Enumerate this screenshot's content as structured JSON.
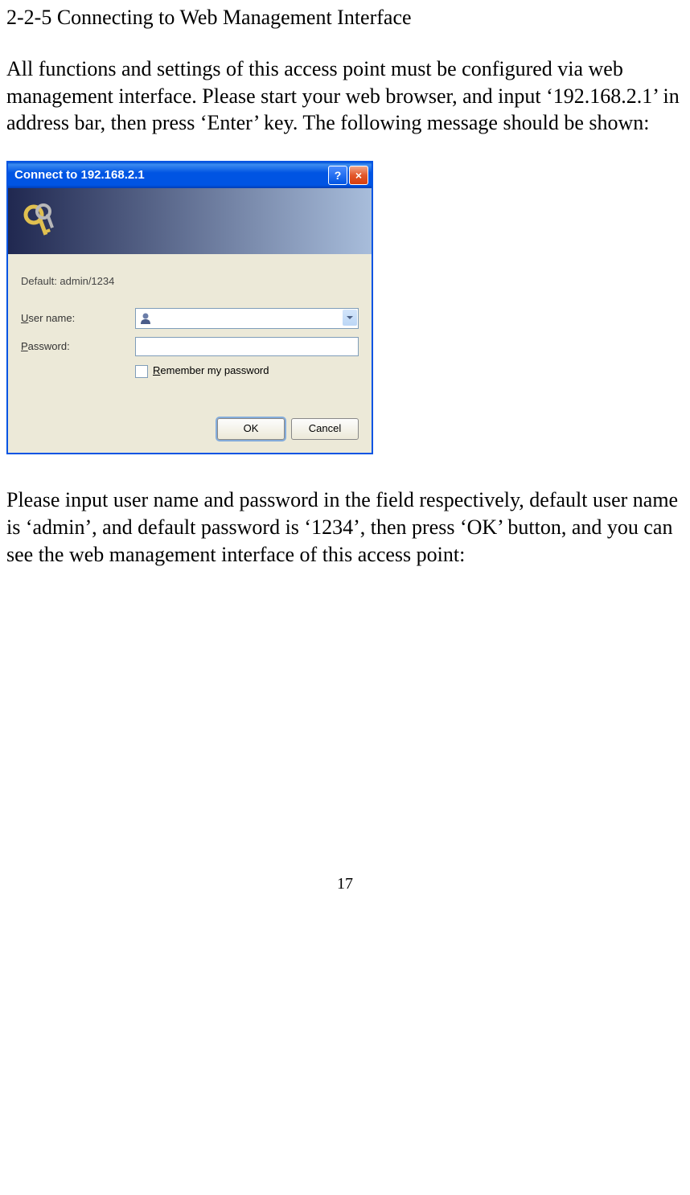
{
  "heading": "2-2-5 Connecting to Web Management Interface",
  "paragraph1": "All functions and settings of this access point must be configured via web management interface. Please start your web browser, and input ‘192.168.2.1’ in address bar, then press ‘Enter’ key. The following message should be shown:",
  "dialog": {
    "title": "Connect to 192.168.2.1",
    "helpLabel": "?",
    "closeLabel": "×",
    "serverText": "Default: admin/1234",
    "userNamePrefix": "U",
    "userNameRest": "ser name:",
    "passwordPrefix": "P",
    "passwordRest": "assword:",
    "rememberPrefix": "R",
    "rememberRest": "emember my password",
    "okButton": "OK",
    "cancelButton": "Cancel",
    "userNameValue": "",
    "passwordValue": ""
  },
  "paragraph2": "Please input user name and password in the field respectively, default user name is ‘admin’, and default password is ‘1234’, then press ‘OK’ button, and you can see the web management interface of this access point:",
  "pageNumber": "17"
}
